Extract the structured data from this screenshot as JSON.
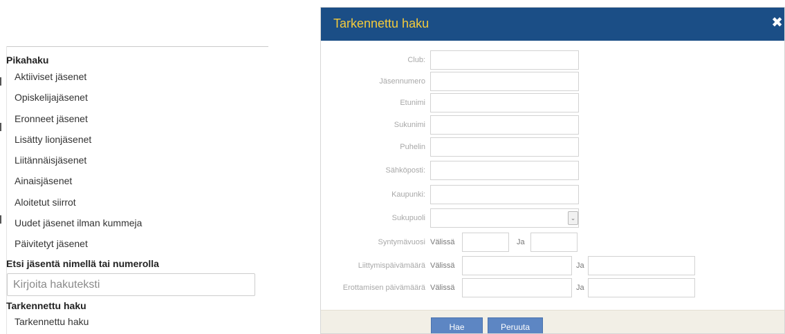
{
  "quick_search": {
    "heading": "Pikahaku",
    "items": [
      {
        "label": "Aktiiviset jäsenet"
      },
      {
        "label": "Opiskelijajäsenet"
      },
      {
        "label": "Eronneet jäsenet"
      },
      {
        "label": "Lisätty lionjäsenet"
      },
      {
        "label": "Liitännäisjäsenet"
      },
      {
        "label": "Ainaisjäsenet"
      },
      {
        "label": "Aloitetut siirrot"
      },
      {
        "label": "Uudet jäsenet ilman kummeja"
      },
      {
        "label": "Päivitetyt jäsenet"
      }
    ]
  },
  "name_search": {
    "heading": "Etsi jäsentä nimellä tai numerolla",
    "placeholder": "Kirjoita hakuteksti",
    "value": ""
  },
  "advanced": {
    "heading": "Tarkennettu haku",
    "link_label": "Tarkennettu haku"
  },
  "modal": {
    "title": "Tarkennettu haku",
    "close_icon": "close-icon",
    "fields": [
      {
        "label": "Club:",
        "value": ""
      },
      {
        "label": "Jäsennumero",
        "value": ""
      },
      {
        "label": "Etunimi",
        "value": ""
      },
      {
        "label": "Sukunimi",
        "value": ""
      },
      {
        "label": "Puhelin",
        "value": ""
      },
      {
        "label": "Sähköposti:",
        "value": ""
      },
      {
        "label": "Kaupunki:",
        "value": ""
      }
    ],
    "gender": {
      "label": "Sukupuoli",
      "value": ""
    },
    "ranges": [
      {
        "label": "Syntymävuosi",
        "between": "Välissä",
        "and": "Ja",
        "from": "",
        "to": ""
      },
      {
        "label": "Liittymispäivämäärä",
        "between": "Välissä",
        "and": "Ja",
        "from": "",
        "to": ""
      },
      {
        "label": "Erottamisen päivämäärä",
        "between": "Välissä",
        "and": "Ja",
        "from": "",
        "to": ""
      }
    ],
    "search_button": "Hae",
    "cancel_button": "Peruuta"
  },
  "colors": {
    "header_bg": "#1b4e86",
    "title": "#f4cb3c",
    "button": "#5d86c3",
    "footer_bg": "#f2efe6"
  }
}
